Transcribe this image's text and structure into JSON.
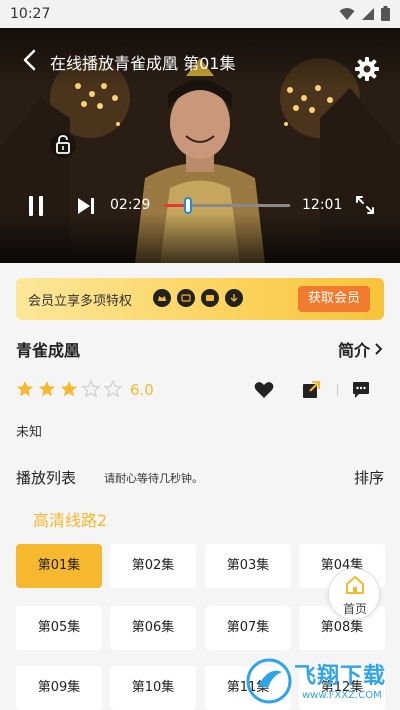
{
  "status_bar": {
    "time": "10:27"
  },
  "player": {
    "title": "在线播放青雀成凰 第01集",
    "current_time": "02:29",
    "total_time": "12:01",
    "progress": 0.193
  },
  "vip_banner": {
    "text": "会员立享多项特权",
    "button_label": "获取会员"
  },
  "show": {
    "title": "青雀成凰",
    "intro_label": "简介",
    "rating": "6.0",
    "stars_filled": 3,
    "stars_total": 5,
    "region": "未知"
  },
  "playlist": {
    "label": "播放列表",
    "hint": "请耐心等待几秒钟。",
    "sort_label": "排序",
    "line_name": "高清线路2",
    "episodes": [
      "第01集",
      "第02集",
      "第03集",
      "第04集",
      "第05集",
      "第06集",
      "第07集",
      "第08集",
      "第09集",
      "第10集",
      "第11集",
      "第12集"
    ],
    "active_index": 0
  },
  "home_button": {
    "label": "首页"
  },
  "watermark": {
    "text": "飞翔下载",
    "url": "www.FXXZ.COM"
  },
  "colors": {
    "accent_yellow": "#f5b82e",
    "vip_button": "#f07b2e",
    "progress_played": "#e53935",
    "progress_knob_border": "#1e88e5"
  }
}
